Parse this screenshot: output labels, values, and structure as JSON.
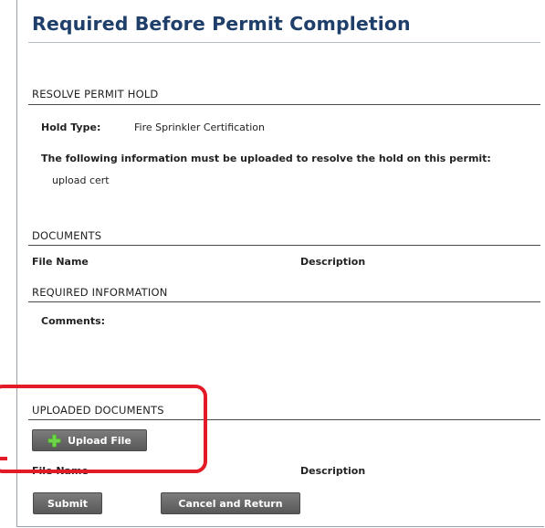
{
  "page": {
    "title": "Required Before Permit Completion"
  },
  "resolve_hold": {
    "section_title": "RESOLVE PERMIT HOLD",
    "hold_type_label": "Hold Type:",
    "hold_type_value": "Fire Sprinkler Certification",
    "instruction": "The following information must be uploaded to resolve the hold on this permit:",
    "required_item": "upload cert"
  },
  "documents": {
    "section_title": "DOCUMENTS",
    "columns": [
      "File Name",
      "Description"
    ]
  },
  "required_information": {
    "section_title": "REQUIRED INFORMATION",
    "comments_label": "Comments:"
  },
  "uploaded_documents": {
    "section_title": "UPLOADED DOCUMENTS",
    "upload_button_label": "Upload File",
    "columns": [
      "File Name",
      "Description"
    ]
  },
  "actions": {
    "submit_label": "Submit",
    "cancel_label": "Cancel and Return"
  },
  "colors": {
    "title": "#1f3f6a",
    "highlight": "#e21b26",
    "button": "#6b6b6b",
    "plus_icon": "#4caf2a"
  },
  "icons": {
    "upload": "plus-icon"
  }
}
